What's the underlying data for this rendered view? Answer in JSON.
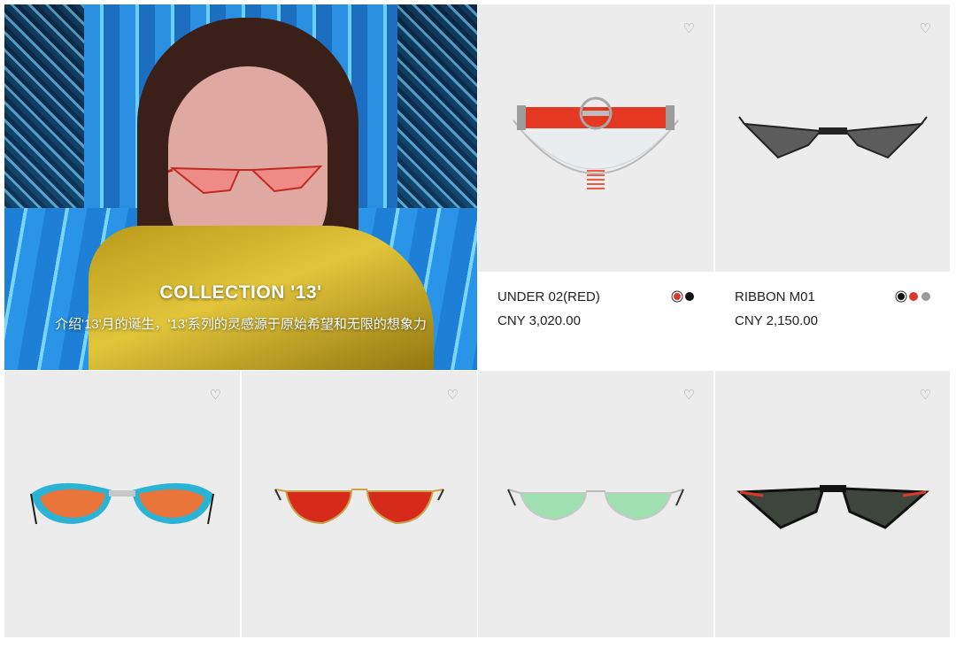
{
  "hero": {
    "title": "COLLECTION '13'",
    "subtitle": "介绍'13'月的诞生，'13'系列的灵感源于原始希望和无限的想象力"
  },
  "products": [
    {
      "name": "UNDER 02(RED)",
      "price": "CNY 3,020.00",
      "colors": [
        "#d93a2b",
        "#111111"
      ],
      "selected_color": 0,
      "icon": "heart-icon"
    },
    {
      "name": "RIBBON M01",
      "price": "CNY 2,150.00",
      "colors": [
        "#111111",
        "#d93a2b",
        "#9a9a9a"
      ],
      "selected_color": 0,
      "icon": "heart-icon"
    },
    {
      "icon": "heart-icon",
      "lens_color": "#e8743a",
      "frame_color": "#2bb3d6"
    },
    {
      "icon": "heart-icon",
      "lens_color": "#d62a1a",
      "frame_color": "#c9a24a"
    },
    {
      "icon": "heart-icon",
      "lens_color": "#9fe0b0",
      "frame_color": "#c7c7c7"
    },
    {
      "icon": "heart-icon",
      "lens_color": "#3e453c",
      "frame_color": "#111111"
    }
  ],
  "colors": {
    "card_background": "#ececec",
    "heart": "#9a9a9a",
    "text": "#222222"
  }
}
